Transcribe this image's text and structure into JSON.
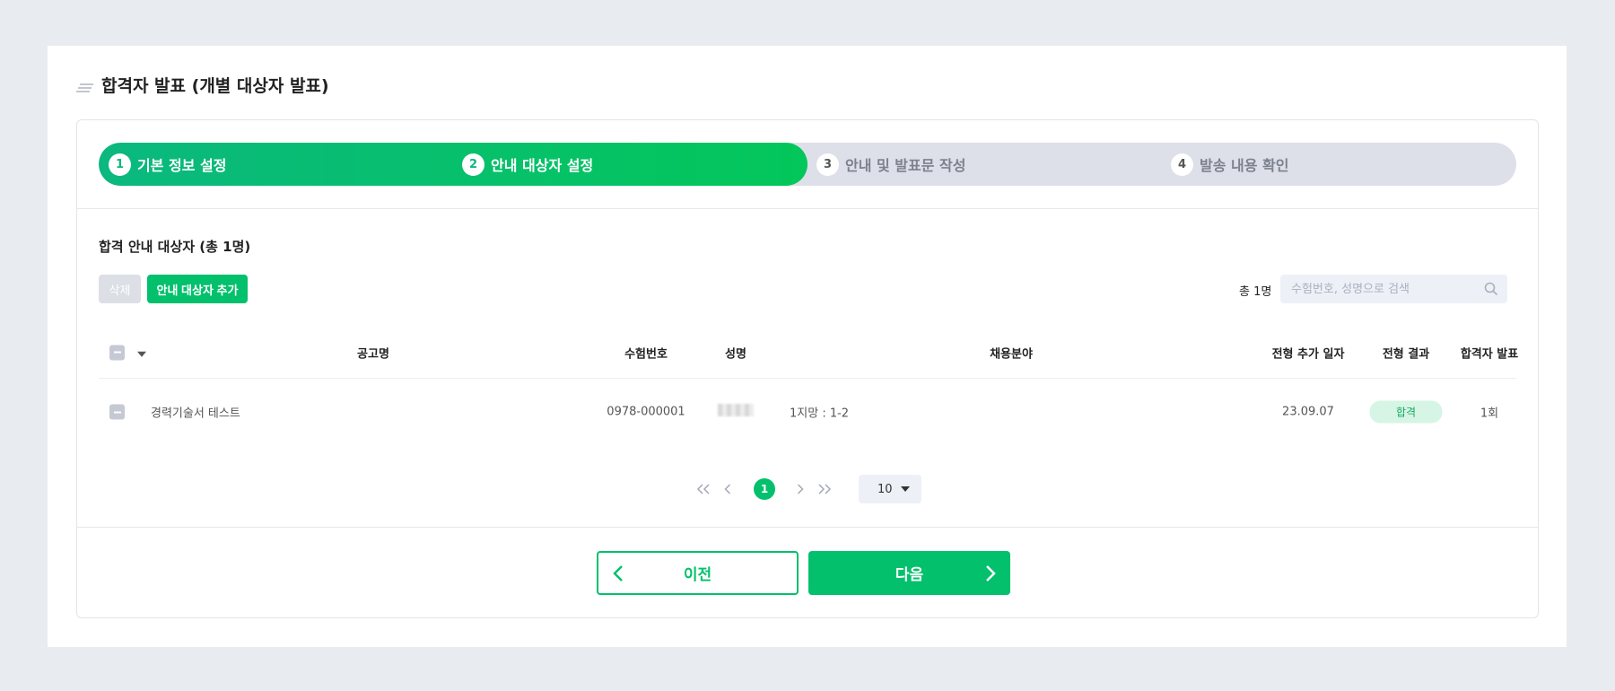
{
  "page": {
    "title": "합격자 발표 (개별 대상자 발표)"
  },
  "steps": [
    {
      "num": "1",
      "label": "기본 정보 설정",
      "state": "done"
    },
    {
      "num": "2",
      "label": "안내 대상자 설정",
      "state": "current"
    },
    {
      "num": "3",
      "label": "안내 및 발표문 작성",
      "state": "todo"
    },
    {
      "num": "4",
      "label": "발송 내용 확인",
      "state": "todo"
    }
  ],
  "section": {
    "title": "합격 안내 대상자 (총 1명)",
    "delete_label": "삭제",
    "add_label": "안내 대상자 추가",
    "total_label": "총 1명",
    "search_placeholder": "수험번호, 성명으로 검색"
  },
  "table": {
    "columns": {
      "notice": "공고명",
      "exam_no": "수험번호",
      "name": "성명",
      "field": "채용분야",
      "added_date": "전형 추가 일자",
      "result": "전형 결과",
      "announce": "합격자 발표"
    },
    "rows": [
      {
        "notice": "경력기술서 테스트",
        "exam_no": "0978-000001",
        "name": "",
        "field": "1지망 : 1-2",
        "added_date": "23.09.07",
        "result": "합격",
        "announce": "1회"
      }
    ]
  },
  "pagination": {
    "current": "1",
    "per_page": "10"
  },
  "footer": {
    "prev_label": "이전",
    "next_label": "다음"
  },
  "colors": {
    "accent": "#03c06c",
    "step_inactive": "#dde0e8",
    "badge_bg": "#d6f5e4"
  }
}
